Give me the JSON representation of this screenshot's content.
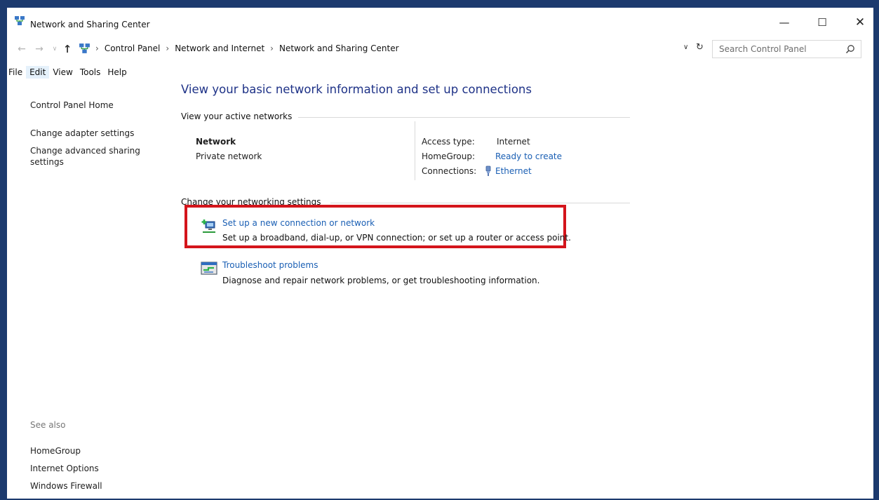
{
  "window": {
    "title": "Network and Sharing Center",
    "controls": {
      "minimize": "—",
      "maximize": "☐",
      "close": "✕"
    }
  },
  "navigation": {
    "back": "←",
    "forward": "→",
    "recent": "∨",
    "up": "↑",
    "breadcrumbs": [
      "Control Panel",
      "Network and Internet",
      "Network and Sharing Center"
    ],
    "dropdown": "∨",
    "refresh": "↻",
    "search_placeholder": "Search Control Panel"
  },
  "menu": [
    "File",
    "Edit",
    "View",
    "Tools",
    "Help"
  ],
  "sidebar": {
    "links": [
      "Control Panel Home",
      "Change adapter settings",
      "Change advanced sharing settings"
    ],
    "see_also_label": "See also",
    "see_also": [
      "HomeGroup",
      "Internet Options",
      "Windows Firewall"
    ]
  },
  "main": {
    "heading": "View your basic network information and set up connections",
    "active_networks_title": "View your active networks",
    "network": {
      "name": "Network",
      "type": "Private network",
      "access_type_label": "Access type:",
      "access_type": "Internet",
      "homegroup_label": "HomeGroup:",
      "homegroup": "Ready to create",
      "connections_label": "Connections:",
      "connections": "Ethernet"
    },
    "settings_title": "Change your networking settings",
    "actions": [
      {
        "link": "Set up a new connection or network",
        "description": "Set up a broadband, dial-up, or VPN connection; or set up a router or access point.",
        "icon": "new-connection-icon"
      },
      {
        "link": "Troubleshoot problems",
        "description": "Diagnose and repair network problems, or get troubleshooting information.",
        "icon": "troubleshoot-icon"
      }
    ]
  },
  "colors": {
    "heading": "#1e3287",
    "link": "#1a5fb4",
    "highlight": "#d4151b",
    "desktop": "#1c3a6e"
  }
}
